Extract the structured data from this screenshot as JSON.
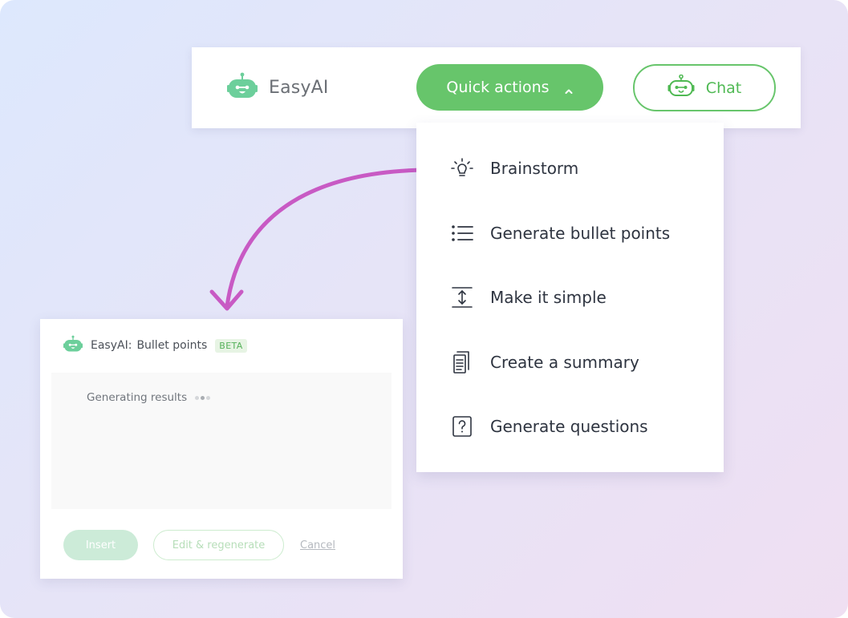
{
  "toolbar": {
    "brand_name": "EasyAI",
    "quick_actions_label": "Quick actions",
    "chat_label": "Chat"
  },
  "menu": {
    "items": [
      {
        "label": "Brainstorm",
        "icon": "lightbulb-icon"
      },
      {
        "label": "Generate bullet points",
        "icon": "bullet-list-icon"
      },
      {
        "label": "Make it simple",
        "icon": "simplify-icon"
      },
      {
        "label": "Create a summary",
        "icon": "document-icon"
      },
      {
        "label": "Generate questions",
        "icon": "question-icon"
      }
    ]
  },
  "panel": {
    "title": "EasyAI:",
    "subtitle": "Bullet points",
    "badge": "BETA",
    "status": "Generating results",
    "insert_label": "Insert",
    "edit_label": "Edit & regenerate",
    "cancel_label": "Cancel"
  },
  "colors": {
    "accent_green": "#67c56b",
    "robot_green": "#6ccf9b",
    "arrow_magenta": "#c85ac4",
    "text_dark": "#2e3440"
  }
}
